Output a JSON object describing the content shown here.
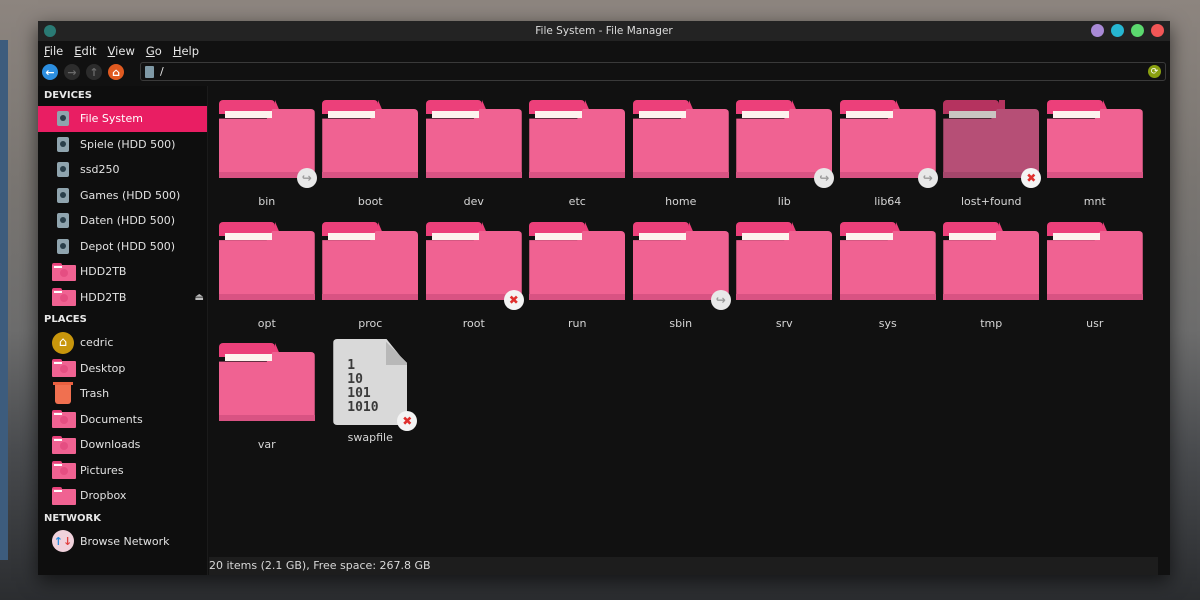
{
  "window": {
    "title": "File System - File Manager",
    "controls": [
      {
        "name": "minimize",
        "color": "#a98ad6"
      },
      {
        "name": "maximize",
        "color": "#26b6d1"
      },
      {
        "name": "restore",
        "color": "#5bd86e"
      },
      {
        "name": "close",
        "color": "#f25656"
      }
    ]
  },
  "menu": [
    {
      "label": "File"
    },
    {
      "label": "Edit"
    },
    {
      "label": "View"
    },
    {
      "label": "Go"
    },
    {
      "label": "Help"
    }
  ],
  "toolbar": {
    "back_icon": "←",
    "forward_icon": "→",
    "up_icon": "↑",
    "home_icon": "⌂",
    "path": "/",
    "reload_icon": "⟳"
  },
  "sidebar": {
    "devices_title": "DEVICES",
    "devices": [
      {
        "label": "File System",
        "icon": "drive",
        "active": true
      },
      {
        "label": "Spiele (HDD 500)",
        "icon": "drive"
      },
      {
        "label": "ssd250",
        "icon": "drive"
      },
      {
        "label": "Games (HDD 500)",
        "icon": "drive"
      },
      {
        "label": "Daten (HDD 500)",
        "icon": "drive"
      },
      {
        "label": "Depot (HDD 500)",
        "icon": "drive"
      },
      {
        "label": "HDD2TB",
        "icon": "folder-drive"
      },
      {
        "label": "HDD2TB",
        "icon": "folder-drive",
        "eject": "⏏"
      }
    ],
    "places_title": "PLACES",
    "places": [
      {
        "label": "cedric",
        "icon": "home"
      },
      {
        "label": "Desktop",
        "icon": "folder-desktop"
      },
      {
        "label": "Trash",
        "icon": "trash"
      },
      {
        "label": "Documents",
        "icon": "folder-documents"
      },
      {
        "label": "Downloads",
        "icon": "folder-downloads"
      },
      {
        "label": "Pictures",
        "icon": "folder-pictures"
      },
      {
        "label": "Dropbox",
        "icon": "folder-dropbox"
      }
    ],
    "network_title": "NETWORK",
    "network": [
      {
        "label": "Browse Network",
        "icon": "network"
      }
    ]
  },
  "files": [
    {
      "name": "bin",
      "type": "folder",
      "emblem": "symlink"
    },
    {
      "name": "boot",
      "type": "folder"
    },
    {
      "name": "dev",
      "type": "folder"
    },
    {
      "name": "etc",
      "type": "folder"
    },
    {
      "name": "home",
      "type": "folder"
    },
    {
      "name": "lib",
      "type": "folder",
      "emblem": "symlink"
    },
    {
      "name": "lib64",
      "type": "folder",
      "emblem": "symlink"
    },
    {
      "name": "lost+found",
      "type": "folder",
      "emblem": "unreadable",
      "dimmed": true
    },
    {
      "name": "mnt",
      "type": "folder"
    },
    {
      "name": "opt",
      "type": "folder"
    },
    {
      "name": "proc",
      "type": "folder"
    },
    {
      "name": "root",
      "type": "folder",
      "emblem": "unreadable"
    },
    {
      "name": "run",
      "type": "folder"
    },
    {
      "name": "sbin",
      "type": "folder",
      "emblem": "symlink"
    },
    {
      "name": "srv",
      "type": "folder"
    },
    {
      "name": "sys",
      "type": "folder"
    },
    {
      "name": "tmp",
      "type": "folder"
    },
    {
      "name": "usr",
      "type": "folder"
    },
    {
      "name": "var",
      "type": "folder"
    },
    {
      "name": "swapfile",
      "type": "binary-file",
      "emblem": "unreadable",
      "glyph": "1\n10\n101\n1010"
    }
  ],
  "emblems": {
    "symlink": "↪",
    "unreadable": "✖"
  },
  "status": "20 items (2.1 GB), Free space: 267.8 GB",
  "colors": {
    "accent": "#e91e63",
    "folder": "#f06292"
  }
}
